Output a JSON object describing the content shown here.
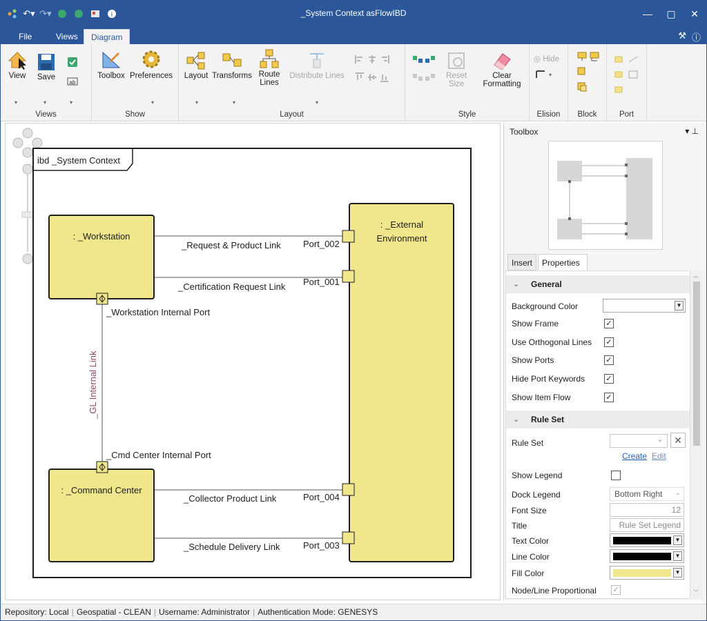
{
  "window": {
    "title": "_System Context asFlowIBD"
  },
  "ribbon_tabs": [
    {
      "label": "File",
      "active": false
    },
    {
      "label": "Views",
      "active": false
    },
    {
      "label": "Diagram",
      "active": true
    }
  ],
  "ribbon": {
    "groups": {
      "views": "Views",
      "show": "Show",
      "layout": "Layout",
      "style": "Style",
      "elision": "Elision",
      "block": "Block",
      "port": "Port"
    },
    "buttons": {
      "view": "View",
      "save": "Save",
      "toolbox": "Toolbox",
      "preferences": "Preferences",
      "layout": "Layout",
      "transforms": "Transforms",
      "route_lines_1": "Route",
      "route_lines_2": "Lines",
      "distribute_lines": "Distribute Lines",
      "reset_size_1": "Reset",
      "reset_size_2": "Size",
      "clear_formatting_1": "Clear",
      "clear_formatting_2": "Formatting",
      "hide": "Hide"
    }
  },
  "diagram": {
    "frame_label": "ibd _System Context",
    "blocks": {
      "workstation": ": _Workstation",
      "command_center": ": _Command Center",
      "external_1": ": _External",
      "external_2": "Environment"
    },
    "links": {
      "request": "_Request & Product Link",
      "certification": "_Certification Request Link",
      "collector": "_Collector Product Link",
      "schedule": "_Schedule Delivery Link",
      "internal": "_GL Internal Link"
    },
    "ports": {
      "p002": "Port_002",
      "p001": "Port_001",
      "p004": "Port_004",
      "p003": "Port_003",
      "workstation_internal": "_Workstation Internal Port",
      "cmd_center_internal": "_Cmd Center Internal Port"
    },
    "colors": {
      "block_fill": "#f0e68c",
      "frame": "#1e1e1e"
    }
  },
  "toolbox": {
    "title": "Toolbox"
  },
  "panel_tabs": [
    {
      "label": "Insert",
      "active": false
    },
    {
      "label": "Properties",
      "active": true
    }
  ],
  "properties": {
    "general": {
      "title": "General",
      "background_color": "Background Color",
      "show_frame": "Show Frame",
      "use_orthogonal_lines": "Use Orthogonal Lines",
      "show_ports": "Show Ports",
      "hide_port_keywords": "Hide Port Keywords",
      "show_item_flow": "Show Item Flow"
    },
    "rule_set": {
      "title": "Rule Set",
      "rule_set": "Rule Set",
      "create": "Create",
      "edit": "Edit",
      "show_legend": "Show Legend",
      "dock_legend": "Dock Legend",
      "dock_legend_value": "Bottom Right",
      "font_size": "Font Size",
      "font_size_value": "12",
      "title_label": "Title",
      "title_value": "Rule Set Legend",
      "text_color": "Text Color",
      "line_color": "Line Color",
      "fill_color": "Fill Color",
      "node_line_proportional": "Node/Line Proportional",
      "text_color_value": "#000000",
      "line_color_value": "#000000",
      "fill_color_value": "#f0e68c"
    },
    "checks": {
      "show_frame": true,
      "use_orthogonal_lines": true,
      "show_ports": true,
      "hide_port_keywords": true,
      "show_item_flow": true,
      "show_legend": false,
      "node_line_proportional": true
    }
  },
  "statusbar": {
    "repository": "Repository: Local",
    "project": "Geospatial - CLEAN",
    "username": "Username: Administrator",
    "auth": "Authentication Mode: GENESYS"
  }
}
